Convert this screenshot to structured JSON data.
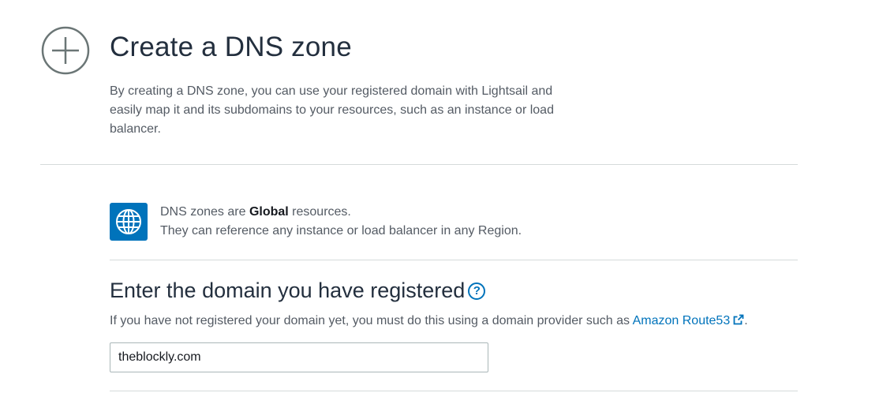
{
  "header": {
    "icon": "plus-circle-icon",
    "title": "Create a DNS zone",
    "description": "By creating a DNS zone, you can use your registered domain with Lightsail and easily map it and its subdomains to your resources, such as an instance or load balancer."
  },
  "info": {
    "icon": "globe-icon",
    "line1_prefix": "DNS zones are ",
    "line1_bold": "Global",
    "line1_suffix": " resources.",
    "line2": "They can reference any instance or load balancer in any Region."
  },
  "domain_section": {
    "title": "Enter the domain you have registered",
    "help_icon": "question-circle-icon",
    "help_glyph": "?",
    "description_prefix": "If you have not registered your domain yet, you must do this using a domain provider such as ",
    "link_text": "Amazon Route53",
    "link_icon": "external-link-icon",
    "description_suffix": ".",
    "input_value": "theblockly.com"
  },
  "colors": {
    "accent": "#0073bb",
    "text_primary": "#232f3e",
    "text_secondary": "#545b64",
    "divider": "#d5dbdb"
  }
}
